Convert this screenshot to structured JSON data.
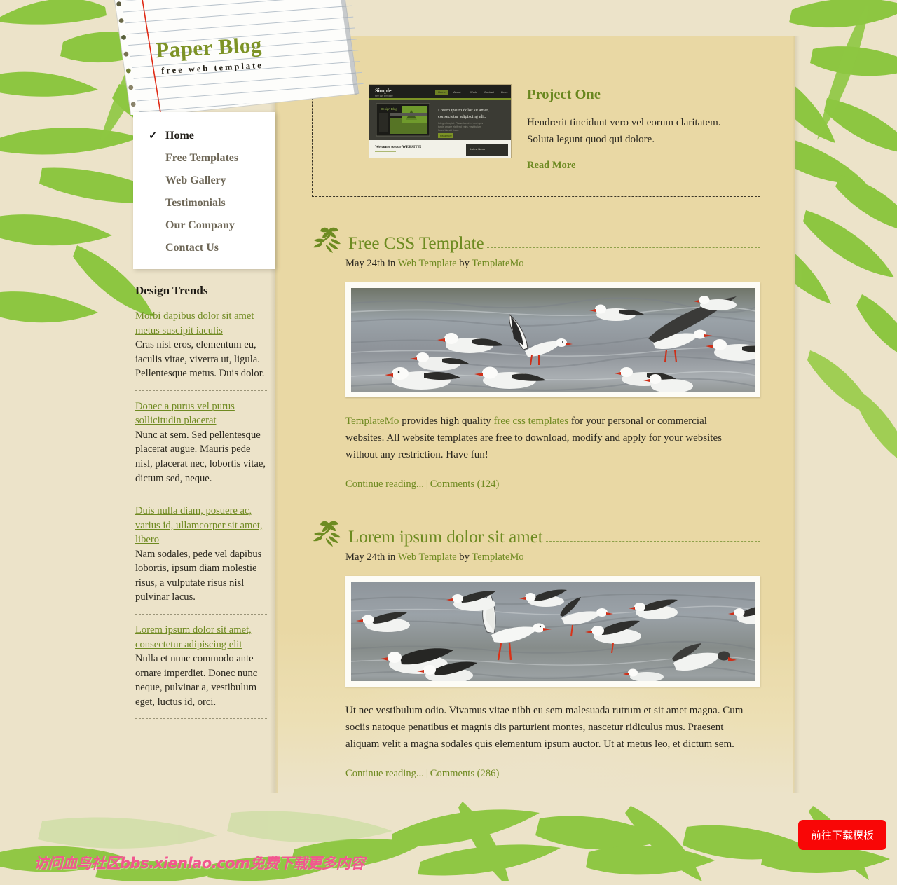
{
  "site": {
    "title": "Paper Blog",
    "tagline": "free web template"
  },
  "nav": {
    "items": [
      {
        "label": "Home",
        "active": true,
        "icon": "check-icon"
      },
      {
        "label": "Free Templates",
        "active": false
      },
      {
        "label": "Web Gallery",
        "active": false
      },
      {
        "label": "Testimonials",
        "active": false
      },
      {
        "label": "Our Company",
        "active": false
      },
      {
        "label": "Contact Us",
        "active": false
      }
    ]
  },
  "sidebar": {
    "heading": "Design Trends",
    "trends": [
      {
        "link": "Morbi dapibus dolor sit amet metus suscipit iaculis",
        "text": "Cras nisl eros, elementum eu, iaculis vitae, viverra ut, ligula. Pellentesque metus. Duis dolor."
      },
      {
        "link": "Donec a purus vel purus sollicitudin placerat",
        "text": "Nunc at sem. Sed pellentesque placerat augue. Mauris pede nisl, placerat nec, lobortis vitae, dictum sed, neque."
      },
      {
        "link": "Duis nulla diam, posuere ac, varius id, ullamcorper sit amet, libero",
        "text": "Nam sodales, pede vel dapibus lobortis, ipsum diam molestie risus, a vulputate risus nisl pulvinar lacus."
      },
      {
        "link": "Lorem ipsum dolor sit amet, consectetur adipiscing elit",
        "text": "Nulla et nunc commodo ante ornare imperdiet. Donec nunc neque, pulvinar a, vestibulum eget, luctus id, orci."
      }
    ]
  },
  "feature": {
    "thumbnail_alt": "website-screenshot-thumbnail",
    "thumbnail": {
      "brand": "Simple",
      "brand_sub": "free css template",
      "nav": [
        "Home",
        "About",
        "Work",
        "Contact",
        "Links"
      ],
      "hero_title_line1": "Lorem ipsum dolor sit amet,",
      "hero_title_line2": "consectetur adipiscing elit.",
      "hero_body": "Integer feugiat. Phasellus ut mi erat quis turpis ornare eleifend enim, vestibulum fusce blandit risus.",
      "hero_button": "Read more",
      "panel_label": "Design Blog",
      "footer_title": "Welcome to our WEBSITE!",
      "footer_box": "Latest News"
    },
    "title": "Project One",
    "body": "Hendrerit tincidunt vero vel eorum claritatem. Soluta legunt quod qui dolore.",
    "read_more": "Read More"
  },
  "posts": [
    {
      "title": "Free CSS Template",
      "meta_date": "May 24th in",
      "meta_category": "Web Template",
      "meta_by": "by",
      "meta_author": "TemplateMo",
      "image_alt": "seagulls-on-water-photo",
      "body_parts": [
        {
          "type": "link",
          "text": "TemplateMo"
        },
        {
          "type": "text",
          "text": " provides high quality "
        },
        {
          "type": "link",
          "text": "free css templates"
        },
        {
          "type": "text",
          "text": " for your personal or commercial websites. All website templates are free to download, modify and apply for your websites without any restriction. Have fun!"
        }
      ],
      "continue_label": "Continue reading...",
      "comments_label": "Comments (124)"
    },
    {
      "title": "Lorem ipsum dolor sit amet",
      "meta_date": "May 24th in",
      "meta_category": "Web Template",
      "meta_by": "by",
      "meta_author": "TemplateMo",
      "image_alt": "flock-of-seagulls-photo",
      "body_parts": [
        {
          "type": "text",
          "text": "Ut nec vestibulum odio. Vivamus vitae nibh eu sem malesuada rutrum et sit amet magna. Cum sociis natoque penatibus et magnis dis parturient montes, nascetur ridiculus mus. Praesent aliquam velit a magna sodales quis elementum ipsum auctor. Ut at metus leo, et dictum sem."
        }
      ],
      "continue_label": "Continue reading...",
      "comments_label": "Comments (286)"
    }
  ],
  "overlay": {
    "watermark": "访问血鸟社区bbs.xienlao.com免费下载更多内容",
    "download_button": "前往下载模板"
  },
  "colors": {
    "accent_green": "#6d8b21",
    "brand_green": "#7d9326",
    "paper": "#e9d8a4",
    "background": "#ece3c9",
    "button_red": "#f90606",
    "watermark_pink": "#f2578f"
  }
}
